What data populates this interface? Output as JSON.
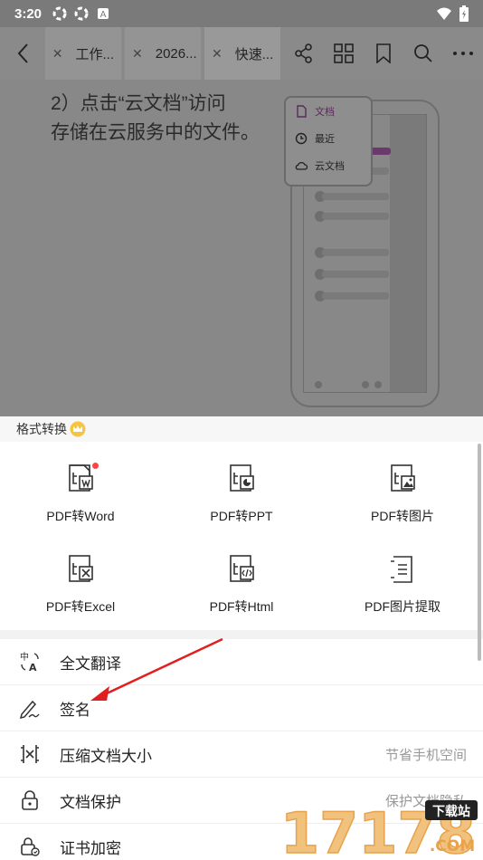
{
  "status_bar": {
    "time": "3:20"
  },
  "tabs": [
    {
      "label": "工作..."
    },
    {
      "label": "2026..."
    },
    {
      "label": "快速..."
    }
  ],
  "document": {
    "line1": "2）点击“云文档”访问",
    "line2": "存储在云服务中的文件。",
    "popup_items": [
      "文档",
      "最近",
      "云文档"
    ]
  },
  "sheet": {
    "header": "格式转换",
    "grid_items": [
      {
        "label": "PDF转Word"
      },
      {
        "label": "PDF转PPT"
      },
      {
        "label": "PDF转图片"
      },
      {
        "label": "PDF转Excel"
      },
      {
        "label": "PDF转Html"
      },
      {
        "label": "PDF图片提取"
      }
    ],
    "list_items": [
      {
        "label": "全文翻译",
        "sub": ""
      },
      {
        "label": "签名",
        "sub": ""
      },
      {
        "label": "压缩文档大小",
        "sub": "节省手机空间"
      },
      {
        "label": "文档保护",
        "sub": "保护文档隐私"
      },
      {
        "label": "证书加密",
        "sub": ""
      }
    ]
  },
  "watermark": {
    "text": "17178",
    "badge": "下载站",
    "domain": ".COM"
  },
  "colors": {
    "accent": "#7b2d7b",
    "red_dot": "#f44444",
    "arrow": "#e02020"
  }
}
